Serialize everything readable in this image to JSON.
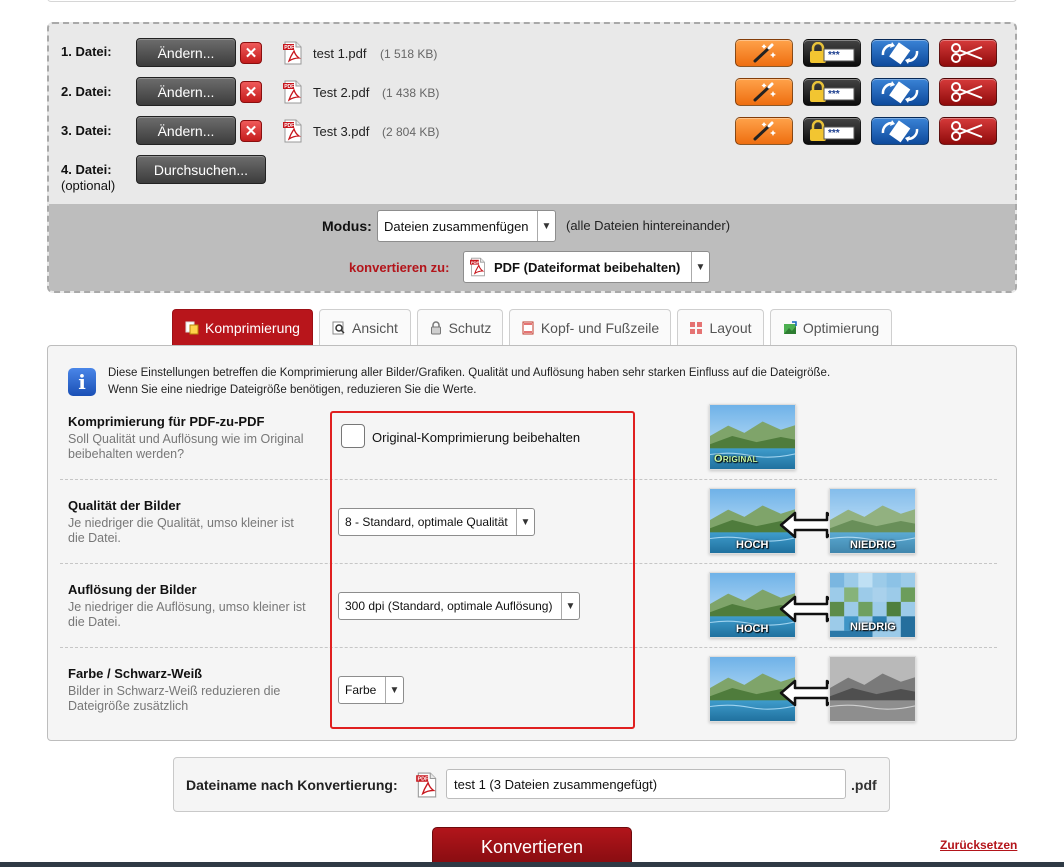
{
  "files": [
    {
      "label": "1. Datei:",
      "button": "Ändern...",
      "name": "test 1.pdf",
      "size": "(1 518 KB)"
    },
    {
      "label": "2. Datei:",
      "button": "Ändern...",
      "name": "Test 2.pdf",
      "size": "(1 438 KB)"
    },
    {
      "label": "3. Datei:",
      "button": "Ändern...",
      "name": "Test 3.pdf",
      "size": "(2 804 KB)"
    }
  ],
  "file4": {
    "label": "4. Datei:",
    "optional": "(optional)",
    "button": "Durchsuchen..."
  },
  "mode": {
    "label": "Modus:",
    "value": "Dateien zusammenfügen",
    "note": "(alle Dateien hintereinander)"
  },
  "convert_to": {
    "label": "konvertieren zu:",
    "value": "PDF (Dateiformat beibehalten)"
  },
  "tabs": [
    {
      "label": "Komprimierung",
      "icon": "compress-icon"
    },
    {
      "label": "Ansicht",
      "icon": "view-icon"
    },
    {
      "label": "Schutz",
      "icon": "lock-icon"
    },
    {
      "label": "Kopf- und Fußzeile",
      "icon": "header-footer-icon"
    },
    {
      "label": "Layout",
      "icon": "layout-icon"
    },
    {
      "label": "Optimierung",
      "icon": "optimize-icon"
    }
  ],
  "info": {
    "line1": "Diese Einstellungen betreffen die Komprimierung aller Bilder/Grafiken. Qualität und Auflösung haben sehr starken Einfluss auf die Dateigröße.",
    "line2": "Wenn Sie eine niedrige Dateigröße benötigen, reduzieren Sie die Werte."
  },
  "rows": {
    "compression": {
      "title": "Komprimierung für PDF-zu-PDF",
      "desc": "Soll Qualität und Auflösung wie im Original beibehalten werden?",
      "checkbox_label": "Original-Komprimierung beibehalten",
      "checked": false,
      "thumb_label": "Original"
    },
    "quality": {
      "title": "Qualität der Bilder",
      "desc": "Je niedriger die Qualität, umso kleiner ist die Datei.",
      "value": "8 - Standard, optimale Qualität",
      "thumb_high": "HOCH",
      "thumb_low": "NIEDRIG"
    },
    "resolution": {
      "title": "Auflösung der Bilder",
      "desc": "Je niedriger die Auflösung, umso kleiner ist die Datei.",
      "value": "300 dpi (Standard, optimale Auflösung)",
      "thumb_high": "HOCH",
      "thumb_low": "NIEDRIG"
    },
    "color": {
      "title": "Farbe / Schwarz-Weiß",
      "desc": "Bilder in Schwarz-Weiß reduzieren die Dateigröße zusätzlich",
      "value": "Farbe"
    }
  },
  "filename": {
    "label": "Dateiname nach Konvertierung:",
    "value": "test 1 (3 Dateien zusammengefügt)",
    "ext": ".pdf"
  },
  "actions": {
    "convert": "Konvertieren",
    "reset": "Zurücksetzen"
  },
  "colors": {
    "brand_red": "#b8151b",
    "highlight_red": "#e02020",
    "tool_orange": "#ee6e10",
    "tool_blue": "#0e4a9c",
    "tool_red": "#8f0b0b"
  }
}
